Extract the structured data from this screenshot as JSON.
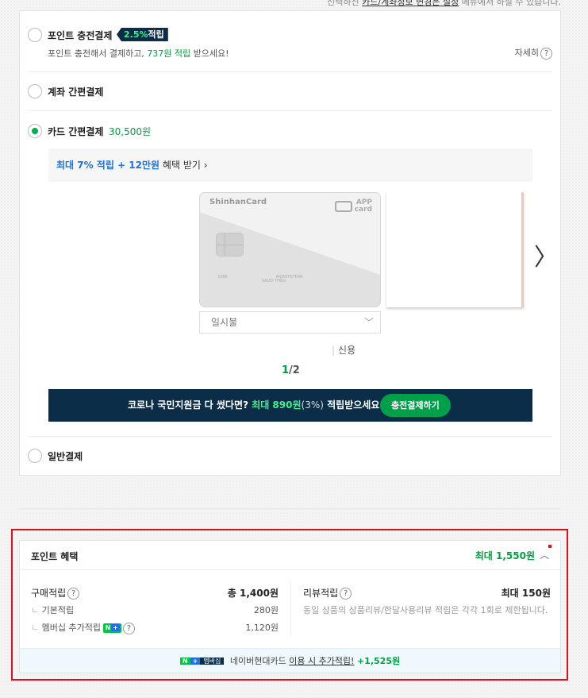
{
  "top_note": {
    "prefix": "선택하신",
    "link": "카드/계좌정보 변경은 설정",
    "suffix": "메뉴에서 하실 수 있습니다."
  },
  "options": {
    "point_charge": {
      "label": "포인트 충전결제",
      "badge_rate": "2.5%",
      "badge_text": "적립",
      "sub_prefix": "포인트 충전해서 결제하고,",
      "sub_amount": "737원 적립",
      "sub_suffix": "받으세요!",
      "detail": "자세히",
      "selected": false
    },
    "account": {
      "label": "계좌 간편결제",
      "selected": false
    },
    "card": {
      "label": "카드 간편결제",
      "price": "30,500원",
      "selected": true
    },
    "general": {
      "label": "일반결제",
      "selected": false
    }
  },
  "card_section": {
    "benefit_bold": "최대 7% 적립 + 12만원",
    "benefit_rest": "혜택 받기 ›",
    "card_brand": "ShinhanCard",
    "card_app_1": "APP",
    "card_app_2": "card",
    "card_tiny_1": "3388",
    "card_tiny_2": "VALID THRU",
    "card_tiny_3": "MONTH/YEAR",
    "installment_value": "일시불",
    "card_kind": "신용",
    "page_current": "1",
    "page_total": "/2",
    "next_icon": "chevron-right-icon"
  },
  "covid_banner": {
    "text_1": "코로나 국민지원금 다 썼다면?",
    "text_green": "최대 890원",
    "text_rate": "(3%)",
    "text_2": "적립받으세요!",
    "button": "충전결제하기"
  },
  "point_benefit": {
    "title": "포인트 혜택",
    "max": "최대 1,550원",
    "purchase": {
      "label": "구매적립",
      "total": "총 1,400원",
      "basic_label": "기본적립",
      "basic_value": "280원",
      "member_label": "멤버십 추가적립",
      "member_value": "1,120원"
    },
    "review": {
      "label": "리뷰적립",
      "max": "최대 150원",
      "desc": "동일 상품의 상품리뷰/한달사용리뷰 적립은 각각 1회로 제한됩니다."
    },
    "footer": {
      "badge_n": "N",
      "badge_plus": "+",
      "badge_text": "멤버십",
      "text_prefix": "네이버현대카드",
      "link": "이용 시 추가적립!",
      "amount": "+1,525원"
    }
  },
  "colors": {
    "accent_green": "#00a040",
    "navy": "#0c2d48",
    "highlight_red": "#e0101a",
    "link_blue": "#1a73e8"
  }
}
